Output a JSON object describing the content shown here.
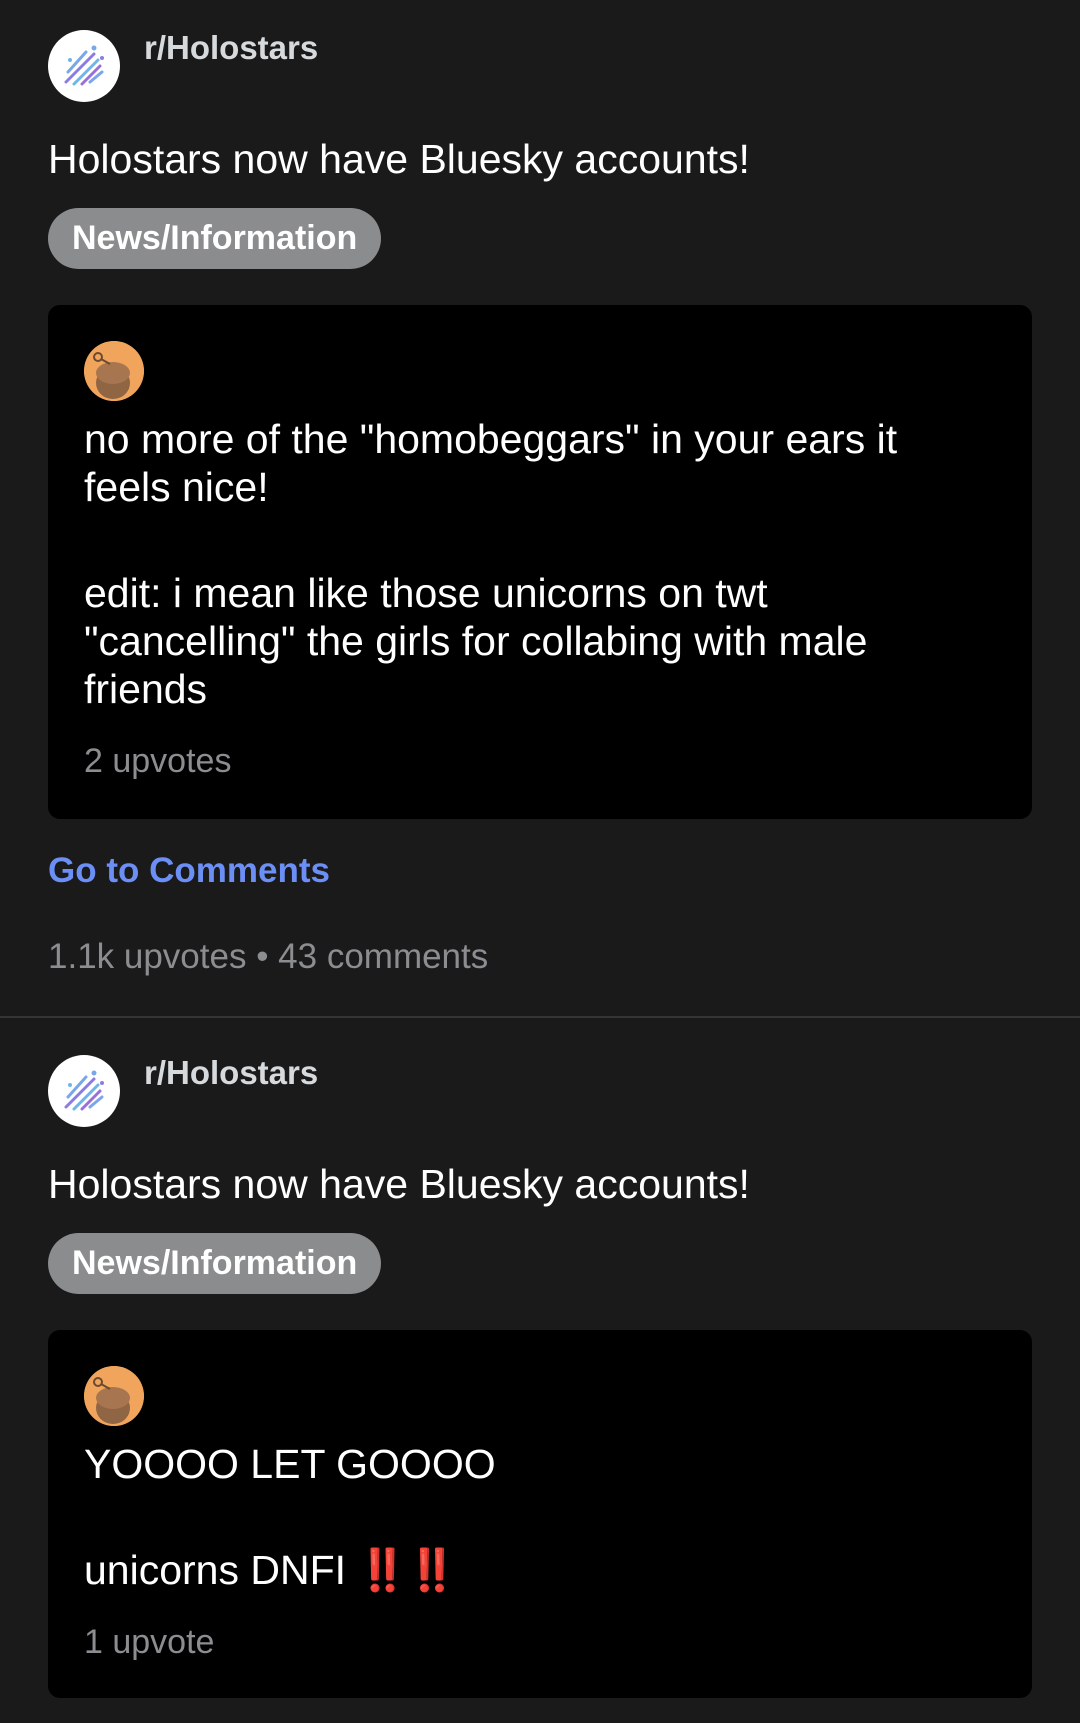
{
  "colors": {
    "background": "#1a1a1b",
    "card": "#000000",
    "flair": "#8a8c8e",
    "link": "#6b8ff5",
    "muted": "#8b8d90",
    "avatar_user": "#f1a55c",
    "emoji": "#e0282c"
  },
  "posts": [
    {
      "subreddit": "r/Holostars",
      "subreddit_icon": "holostars-logo-icon",
      "title": "Holostars now have Bluesky accounts!",
      "flair": "News/Information",
      "comment": {
        "avatar_icon": "reddit-snoo-avatar-icon",
        "paragraphs": [
          "no more of the \"homobeggars\" in your ears it feels nice!",
          "edit: i mean like those unicorns on twt \"cancelling\" the girls for collabing with male friends"
        ],
        "upvotes": "2 upvotes"
      },
      "go_to_comments": "Go to Comments",
      "stats": "1.1k upvotes • 43 comments"
    },
    {
      "subreddit": "r/Holostars",
      "subreddit_icon": "holostars-logo-icon",
      "title": "Holostars now have Bluesky accounts!",
      "flair": "News/Information",
      "comment": {
        "avatar_icon": "reddit-snoo-avatar-icon",
        "line1": "YOOOO LET GOOOO",
        "line2_text": "unicorns DNFI ",
        "line2_emoji": "‼️‼️",
        "upvotes": "1 upvote"
      }
    }
  ]
}
